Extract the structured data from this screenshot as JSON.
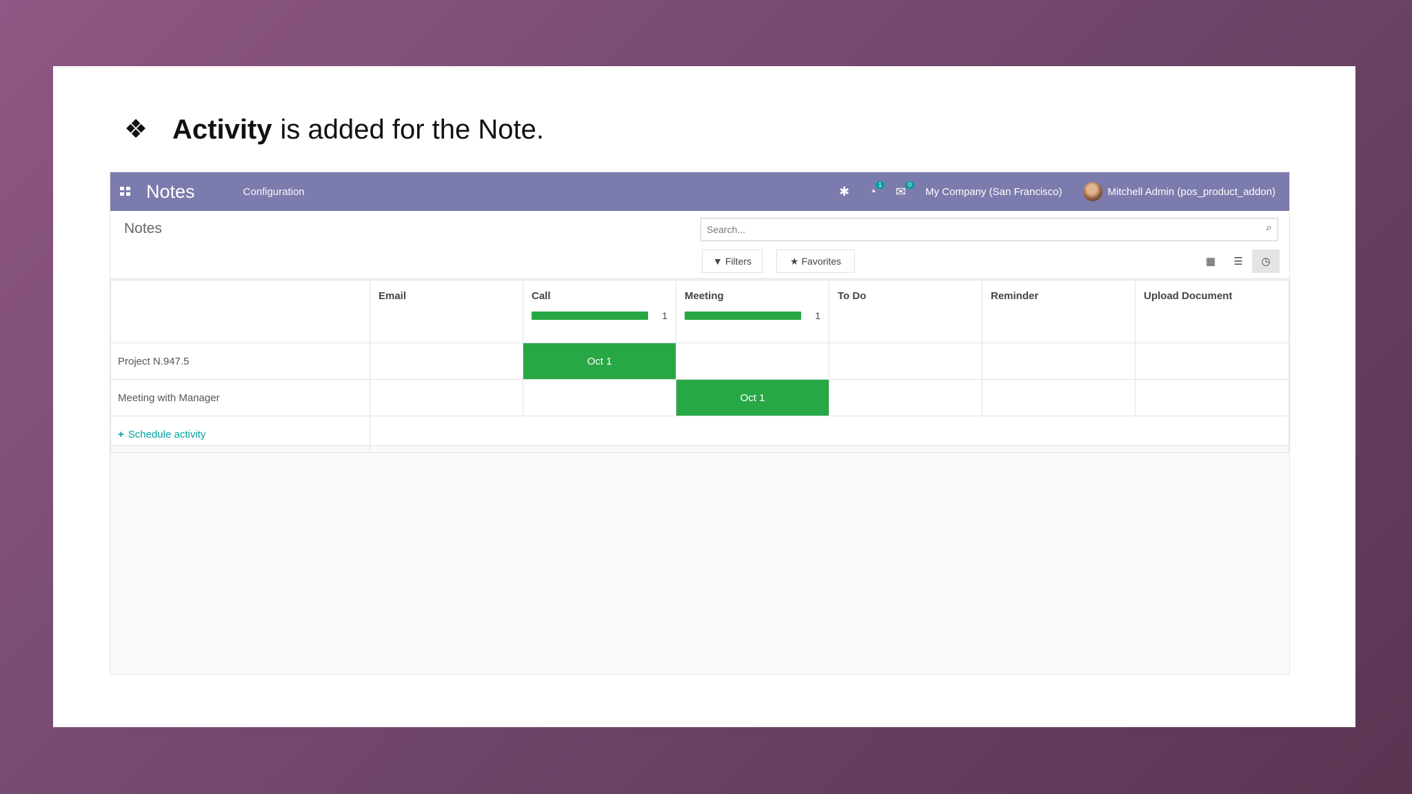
{
  "caption": {
    "bullet": "❖",
    "bold": "Activity",
    "rest": "is added for the Note."
  },
  "navbar": {
    "app_name": "Notes",
    "menu": "Configuration",
    "activity_badge": "1",
    "message_badge": "0",
    "company": "My Company (San Francisco)",
    "user": "Mitchell Admin (pos_product_addon)"
  },
  "control_panel": {
    "breadcrumb": "Notes",
    "search_placeholder": "Search...",
    "filters_label": "Filters",
    "favorites_label": "Favorites"
  },
  "activity_view": {
    "columns": [
      {
        "label": "Email",
        "count": null
      },
      {
        "label": "Call",
        "count": "1"
      },
      {
        "label": "Meeting",
        "count": "1"
      },
      {
        "label": "To Do",
        "count": null
      },
      {
        "label": "Reminder",
        "count": null
      },
      {
        "label": "Upload Document",
        "count": null
      }
    ],
    "rows": [
      {
        "name": "Project N.947.5",
        "call": "Oct 1"
      },
      {
        "name": "Meeting with Manager",
        "meeting": "Oct 1"
      }
    ],
    "schedule_label": "Schedule activity"
  },
  "colors": {
    "navbar": "#7c7bad",
    "activity_green": "#28a745",
    "link_teal": "#00a09d"
  }
}
